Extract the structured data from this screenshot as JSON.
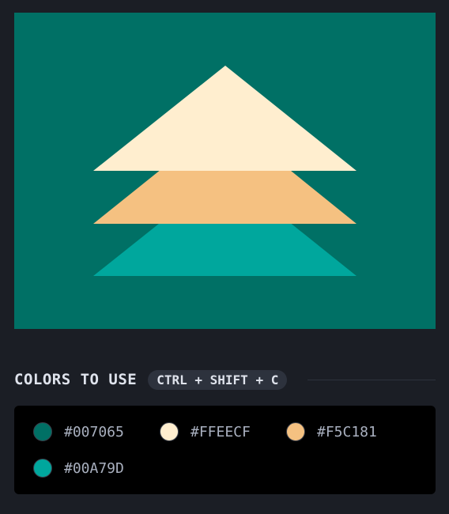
{
  "preview": {
    "background": "#007065",
    "shapes": [
      {
        "name": "triangle-bottom",
        "color": "#00A79D"
      },
      {
        "name": "triangle-middle",
        "color": "#F5C181"
      },
      {
        "name": "triangle-top",
        "color": "#FFEECF"
      }
    ]
  },
  "colors_section": {
    "title": "COLORS TO USE",
    "shortcut": "CTRL + SHIFT + C"
  },
  "swatches": [
    {
      "hex": "#007065",
      "color": "#007065"
    },
    {
      "hex": "#FFEECF",
      "color": "#FFEECF"
    },
    {
      "hex": "#F5C181",
      "color": "#F5C181"
    },
    {
      "hex": "#00A79D",
      "color": "#00A79D"
    }
  ]
}
